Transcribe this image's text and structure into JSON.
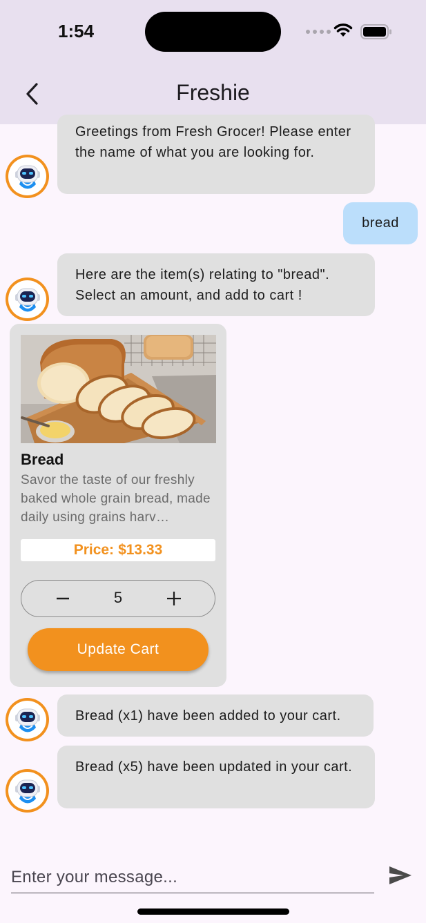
{
  "status_bar": {
    "time": "1:54"
  },
  "app_bar": {
    "title": "Freshie"
  },
  "messages": [
    {
      "from": "bot",
      "text": "Greetings from Fresh Grocer! Please enter the name of what you are looking for."
    },
    {
      "from": "user",
      "text": "bread"
    },
    {
      "from": "bot",
      "text": "Here are the item(s) relating to \"bread\". Select an amount, and add to cart !"
    },
    {
      "from": "bot",
      "text": "Bread (x1) have been added to your cart."
    },
    {
      "from": "bot",
      "text": "Bread (x5) have been updated in your cart."
    }
  ],
  "product": {
    "name": "Bread",
    "description": "Savor the taste of our freshly baked whole grain bread, made daily using grains harv…",
    "price_label": "Price:",
    "price": "$13.33",
    "quantity": "5",
    "button_label": "Update Cart"
  },
  "composer": {
    "placeholder": "Enter your message..."
  },
  "colors": {
    "accent": "#f2911e",
    "app_bar": "#e8e0ef",
    "background": "#fcf5fd",
    "bot_bubble": "#e0e0e0",
    "user_bubble": "#bbdefb"
  },
  "icons": {
    "back": "chevron-left-icon",
    "avatar": "robot-icon",
    "send": "send-icon",
    "minus": "minus-icon",
    "plus": "plus-icon"
  }
}
